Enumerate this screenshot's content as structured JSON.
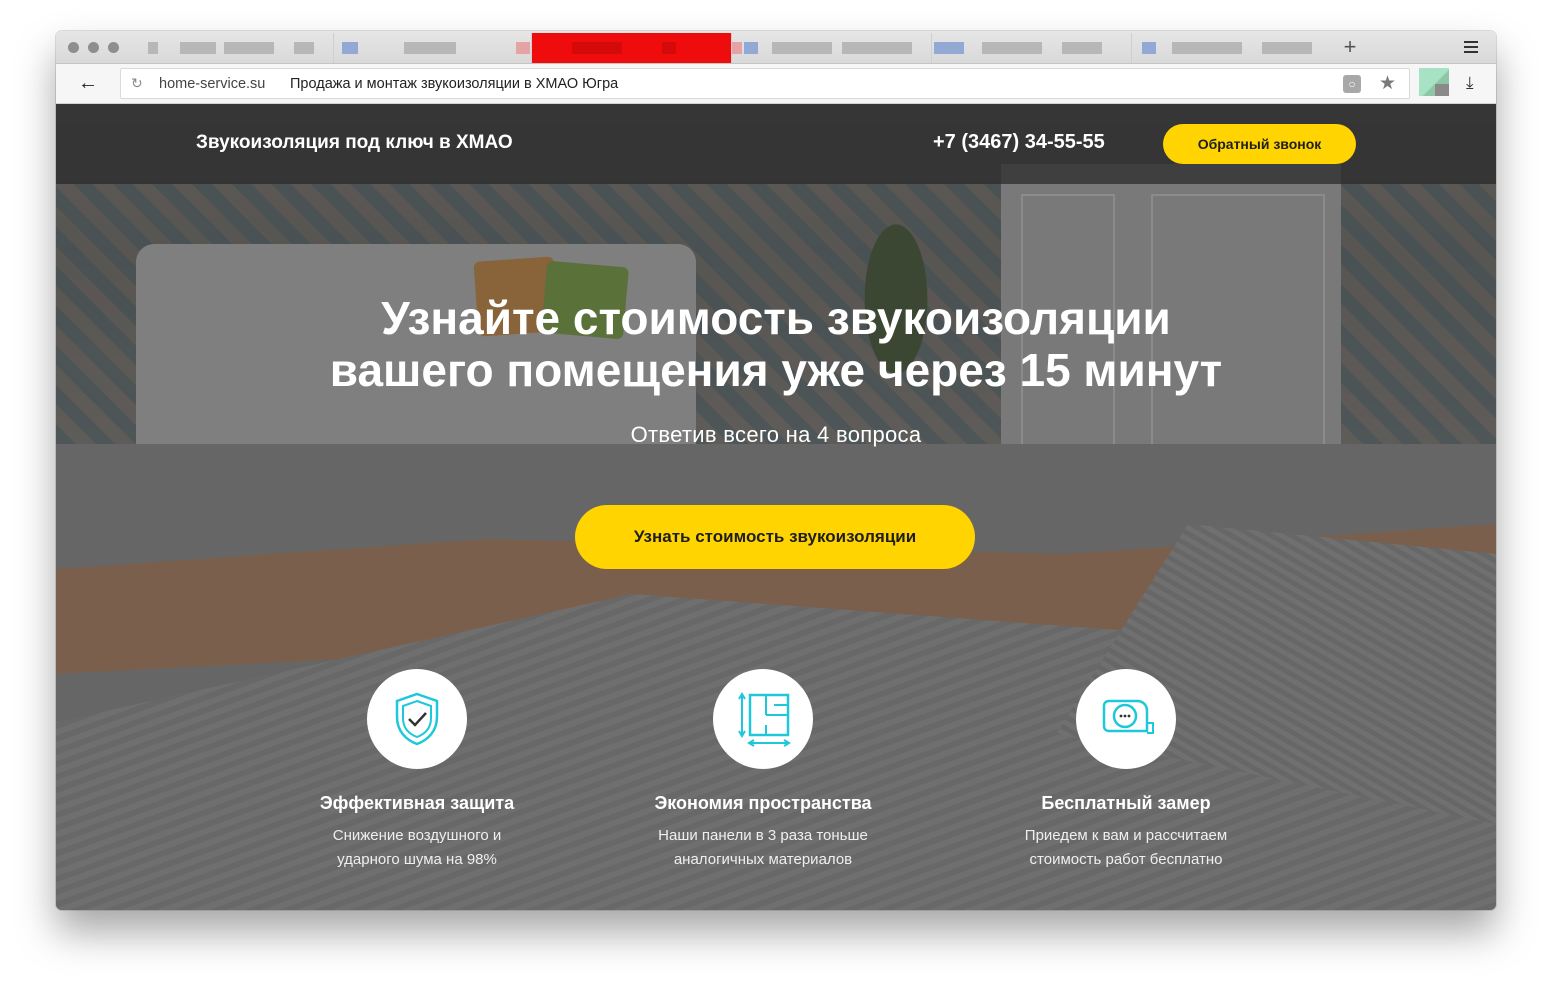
{
  "browser": {
    "url": "home-service.su",
    "page_title": "Продажа и монтаж звукоизоляции в ХМАО Югра",
    "new_tab_label": "+"
  },
  "header": {
    "logo_text": "Звукоизоляция под ключ в ХМАО",
    "phone": "+7 (3467) 34-55-55",
    "callback_label": "Обратный звонок"
  },
  "hero": {
    "title_line1": "Узнайте стоимость звукоизоляции",
    "title_line2": "вашего помещения уже через 15 минут",
    "subtitle": "Ответив всего на 4 вопроса",
    "cta_label": "Узнать стоимость звукоизоляции"
  },
  "features": [
    {
      "icon": "shield-check-icon",
      "title": "Эффективная защита",
      "text_line1": "Снижение воздушного и",
      "text_line2": "ударного шума на 98%"
    },
    {
      "icon": "floor-plan-icon",
      "title": "Экономия пространства",
      "text_line1": "Наши панели в 3 раза тоньше",
      "text_line2": "аналогичных материалов"
    },
    {
      "icon": "tape-measure-icon",
      "title": "Бесплатный замер",
      "text_line1": "Приедем к вам и рассчитаем",
      "text_line2": "стоимость работ бесплатно"
    }
  ],
  "colors": {
    "accent_yellow": "#ffd400",
    "icon_cyan": "#1ec8d8",
    "active_tab_red": "#ee0c0c"
  }
}
